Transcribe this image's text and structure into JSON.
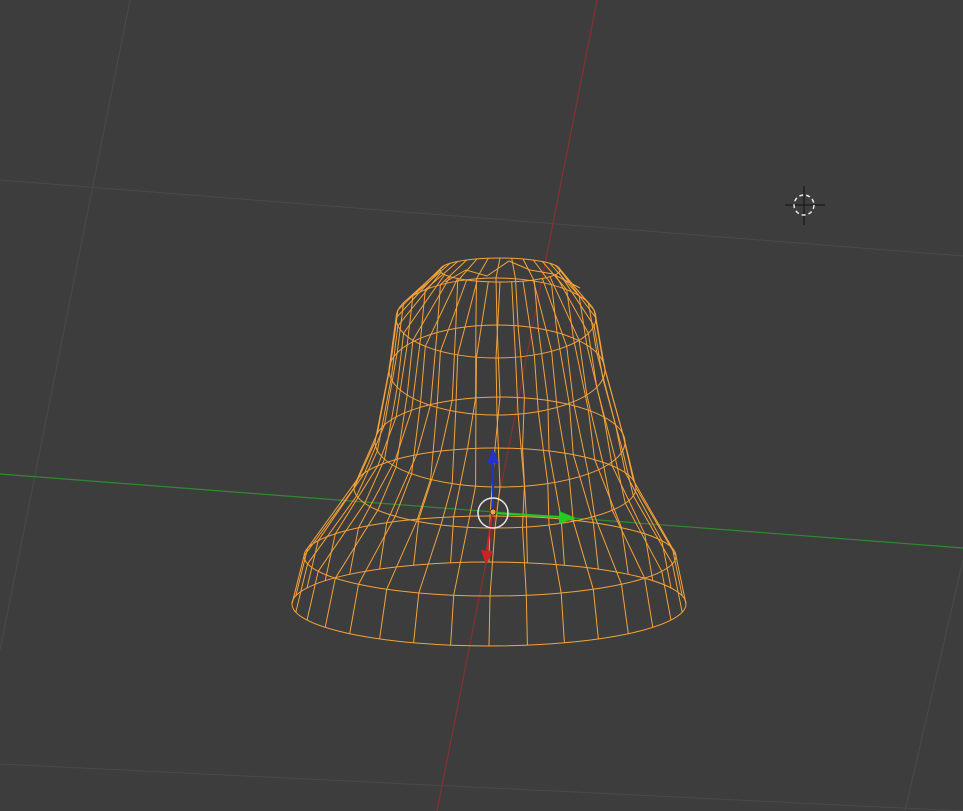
{
  "viewport": {
    "view_mode": "wireframe",
    "background_color": "#3d3d3d",
    "grid_color": "#4a4a4a",
    "axis_colors": {
      "x": "#8a2f2f",
      "y": "#2f8a2f"
    },
    "selection_color": "#f5a33a"
  },
  "object": {
    "shape": "bell",
    "selected": true
  },
  "widgets": {
    "manipulator": {
      "axes": [
        "x",
        "y",
        "z"
      ],
      "colors": {
        "x": "#cc2222",
        "y": "#22cc22",
        "z": "#2233cc"
      }
    },
    "cursor_icon": "3d-cursor-icon",
    "origin_icon": "object-origin-icon"
  }
}
